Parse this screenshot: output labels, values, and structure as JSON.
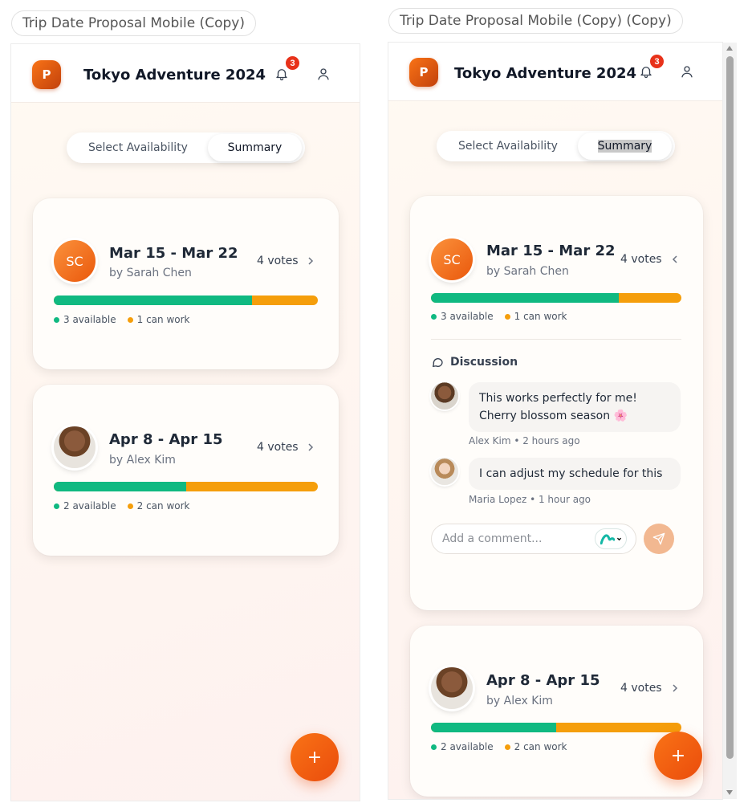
{
  "left_frame": {
    "label": "Trip Date Proposal Mobile (Copy)",
    "app": {
      "logo_letter": "P",
      "title": "Tokyo Adventure 2024",
      "notification_count": "3",
      "tabs": [
        {
          "label": "Select Availability",
          "active": false
        },
        {
          "label": "Summary",
          "active": true
        }
      ]
    },
    "proposals": [
      {
        "avatar_initials": "SC",
        "date_range": "Mar 15 - Mar 22",
        "proposer": "by Sarah Chen",
        "votes": "4 votes",
        "available_fraction": 0.75,
        "available_label": "3 available",
        "can_work_label": "1 can work"
      },
      {
        "avatar_initials": "",
        "date_range": "Apr 8 - Apr 15",
        "proposer": "by Alex Kim",
        "votes": "4 votes",
        "available_fraction": 0.5,
        "available_label": "2 available",
        "can_work_label": "2 can work"
      }
    ],
    "fab_icon": "plus-icon",
    "fab_symbol": "+"
  },
  "right_frame": {
    "label": "Trip Date Proposal Mobile (Copy) (Copy)",
    "app": {
      "logo_letter": "P",
      "title": "Tokyo Adventure 2024",
      "notification_count": "3",
      "tabs": [
        {
          "label": "Select Availability",
          "active": false
        },
        {
          "label": "Summary",
          "active": true
        }
      ]
    },
    "proposals": [
      {
        "avatar_initials": "SC",
        "date_range": "Mar 15 - Mar 22",
        "proposer": "by Sarah Chen",
        "votes": "4 votes",
        "available_fraction": 0.75,
        "available_label": "3 available",
        "can_work_label": "1 can work",
        "expanded": true,
        "discussion": {
          "heading": "Discussion",
          "comments": [
            {
              "text": "This works perfectly for me! Cherry blossom season 🌸",
              "author_time": "Alex Kim • 2 hours ago"
            },
            {
              "text": "I can adjust my schedule for this",
              "author_time": "Maria Lopez • 1 hour ago"
            }
          ],
          "input_placeholder": "Add a comment..."
        }
      },
      {
        "avatar_initials": "",
        "date_range": "Apr 8 - Apr 15",
        "proposer": "by Alex Kim",
        "votes": "4 votes",
        "available_fraction": 0.5,
        "available_label": "2 available",
        "can_work_label": "2 can work"
      }
    ],
    "fab_icon": "plus-icon",
    "fab_symbol": "+"
  },
  "colors": {
    "accent": "#ea580c",
    "available": "#10b981",
    "can_work": "#f59e0b",
    "badge": "#e8321a"
  }
}
